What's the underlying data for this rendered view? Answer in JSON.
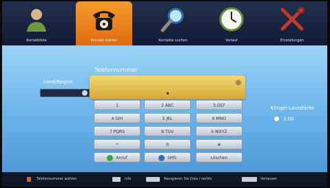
{
  "menu": {
    "items": [
      {
        "label": "Kontaktliste"
      },
      {
        "label": "Kontakt wählen"
      },
      {
        "label": "Kontakte suchen"
      },
      {
        "label": "Verlauf"
      },
      {
        "label": "Einstellungen"
      }
    ]
  },
  "dialer": {
    "country_label": "Land/Region",
    "phone_label": "Telefonnummer",
    "input_value": "",
    "keys": [
      [
        "1",
        "2 ABC",
        "3 DEF"
      ],
      [
        "4 GHI",
        "5 JKL",
        "6 MNO"
      ],
      [
        "7 PQRS",
        "8 TUV",
        "9 WXYZ"
      ],
      [
        "*",
        "0",
        "#"
      ]
    ],
    "actions": {
      "call": "Anruf",
      "sms": "SMS",
      "clear": "Löschen"
    }
  },
  "volume": {
    "label": "Klingel-Lautstärke",
    "value": "3.00"
  },
  "help": {
    "items": [
      "Telefonnummer wählen",
      "Info",
      "Navigieren Sie links / rechts",
      "Verlassen"
    ]
  },
  "colors": {
    "accent": "#f08a22",
    "bar": "#1a233e",
    "background": "#7fc0ef",
    "input": "#e6c152",
    "call_icon": "#2fa84a",
    "sms_icon": "#2a6fb8"
  }
}
